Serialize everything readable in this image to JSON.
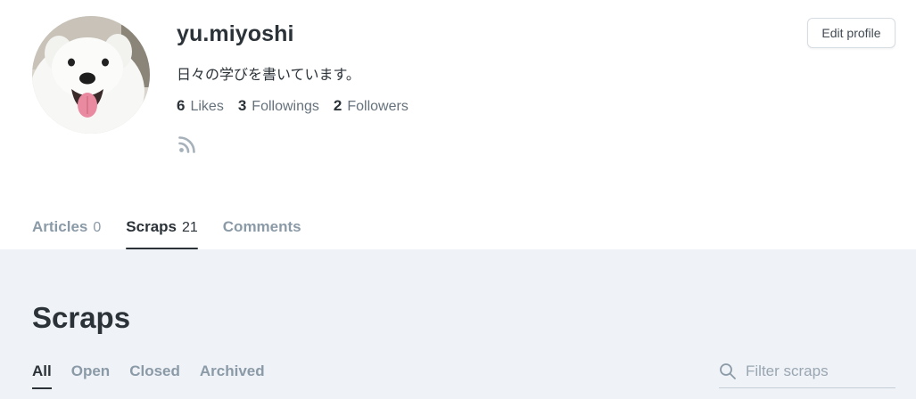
{
  "profile": {
    "username": "yu.miyoshi",
    "bio": "日々の学びを書いています。",
    "stats": [
      {
        "count": "6",
        "label": "Likes"
      },
      {
        "count": "3",
        "label": "Followings"
      },
      {
        "count": "2",
        "label": "Followers"
      }
    ],
    "edit_button_label": "Edit profile"
  },
  "tabs": [
    {
      "label": "Articles",
      "count": "0",
      "active": false
    },
    {
      "label": "Scraps",
      "count": "21",
      "active": true
    },
    {
      "label": "Comments",
      "count": "",
      "active": false
    }
  ],
  "section": {
    "title": "Scraps",
    "filters": [
      "All",
      "Open",
      "Closed",
      "Archived"
    ],
    "active_filter": "All",
    "search_placeholder": "Filter scraps",
    "search_value": ""
  },
  "icons": {
    "rss": "rss-icon",
    "search": "search-icon",
    "avatar": "samoyed-dog-photo"
  },
  "colors": {
    "text_primary": "#2b3238",
    "text_muted": "#8b9aa7",
    "section_background": "#eff2f7",
    "rss_icon": "#a7b1ba"
  }
}
